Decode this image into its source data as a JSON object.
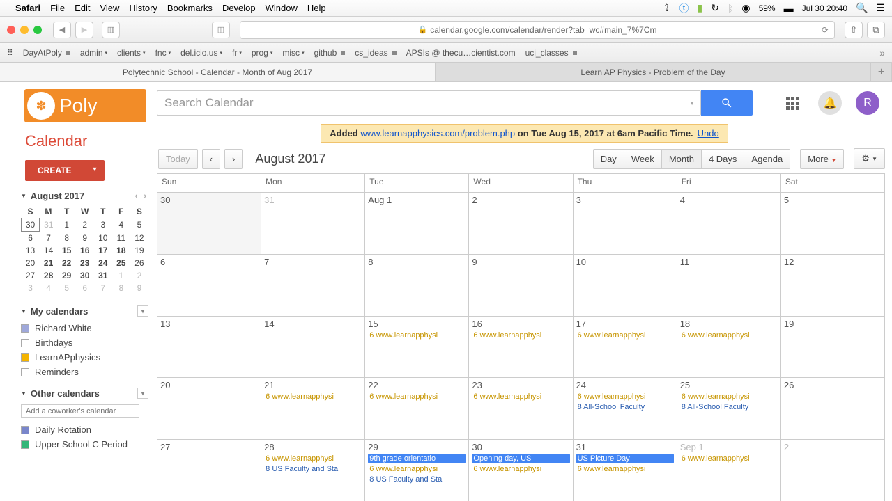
{
  "menubar": {
    "app": "Safari",
    "items": [
      "File",
      "Edit",
      "View",
      "History",
      "Bookmarks",
      "Develop",
      "Window",
      "Help"
    ],
    "battery": "59%",
    "datetime": "Jul 30  20:40"
  },
  "toolbar": {
    "url": "calendar.google.com/calendar/render?tab=wc#main_7%7Cm"
  },
  "favbar": [
    "DayAtPoly",
    "admin",
    "clients",
    "fnc",
    "del.icio.us",
    "fr",
    "prog",
    "misc",
    "github",
    "cs_ideas",
    "APSIs @ thecu…cientist.com",
    "uci_classes"
  ],
  "tabs": [
    "Polytechnic School - Calendar - Month of Aug 2017",
    "Learn AP Physics - Problem of the Day"
  ],
  "logo": "Poly",
  "search": {
    "placeholder": "Search Calendar"
  },
  "notif": {
    "prefix": "Added ",
    "link": "www.learnapphysics.com/problem.php",
    "suffix": " on Tue Aug 15, 2017 at 6am Pacific Time.",
    "undo": "Undo"
  },
  "calhdr": {
    "today": "Today",
    "month": "August 2017",
    "views": [
      "Day",
      "Week",
      "Month",
      "4 Days",
      "Agenda"
    ],
    "more": "More"
  },
  "sidebar": {
    "title": "Calendar",
    "create": "CREATE",
    "mini_month": "August 2017",
    "dow": [
      "S",
      "M",
      "T",
      "W",
      "T",
      "F",
      "S"
    ],
    "mini": [
      [
        {
          "n": "30",
          "t": "today"
        },
        {
          "n": "31",
          "t": "dim"
        },
        {
          "n": "1"
        },
        {
          "n": "2"
        },
        {
          "n": "3"
        },
        {
          "n": "4"
        },
        {
          "n": "5"
        }
      ],
      [
        {
          "n": "6"
        },
        {
          "n": "7"
        },
        {
          "n": "8"
        },
        {
          "n": "9"
        },
        {
          "n": "10"
        },
        {
          "n": "11"
        },
        {
          "n": "12"
        }
      ],
      [
        {
          "n": "13"
        },
        {
          "n": "14"
        },
        {
          "n": "15",
          "t": "bold"
        },
        {
          "n": "16",
          "t": "bold"
        },
        {
          "n": "17",
          "t": "bold"
        },
        {
          "n": "18",
          "t": "bold"
        },
        {
          "n": "19"
        }
      ],
      [
        {
          "n": "20"
        },
        {
          "n": "21",
          "t": "bold"
        },
        {
          "n": "22",
          "t": "bold"
        },
        {
          "n": "23",
          "t": "bold"
        },
        {
          "n": "24",
          "t": "bold"
        },
        {
          "n": "25",
          "t": "bold"
        },
        {
          "n": "26"
        }
      ],
      [
        {
          "n": "27"
        },
        {
          "n": "28",
          "t": "bold"
        },
        {
          "n": "29",
          "t": "bold"
        },
        {
          "n": "30",
          "t": "bold"
        },
        {
          "n": "31",
          "t": "bold"
        },
        {
          "n": "1",
          "t": "dim"
        },
        {
          "n": "2",
          "t": "dim"
        }
      ],
      [
        {
          "n": "3",
          "t": "dim"
        },
        {
          "n": "4",
          "t": "dim"
        },
        {
          "n": "5",
          "t": "dim"
        },
        {
          "n": "6",
          "t": "dim"
        },
        {
          "n": "7",
          "t": "dim"
        },
        {
          "n": "8",
          "t": "dim"
        },
        {
          "n": "9",
          "t": "dim"
        }
      ]
    ],
    "mycal_h": "My calendars",
    "mycal": [
      {
        "name": "Richard White",
        "c": "#9fa8da"
      },
      {
        "name": "Birthdays",
        "c": "#fff"
      },
      {
        "name": "LearnAPphysics",
        "c": "#f4b400"
      },
      {
        "name": "Reminders",
        "c": "#fff"
      }
    ],
    "othercal_h": "Other calendars",
    "addcow": "Add a coworker's calendar",
    "othercal": [
      {
        "name": "Daily Rotation",
        "c": "#7986cb"
      },
      {
        "name": "Upper School C Period",
        "c": "#33b679"
      }
    ]
  },
  "grid": {
    "dow": [
      "Sun",
      "Mon",
      "Tue",
      "Wed",
      "Thu",
      "Fri",
      "Sat"
    ],
    "weeks": [
      [
        {
          "n": "30",
          "dim": false,
          "past": true
        },
        {
          "n": "31",
          "dim": true
        },
        {
          "n": "Aug 1"
        },
        {
          "n": "2"
        },
        {
          "n": "3"
        },
        {
          "n": "4"
        },
        {
          "n": "5"
        }
      ],
      [
        {
          "n": "6"
        },
        {
          "n": "7"
        },
        {
          "n": "8"
        },
        {
          "n": "9"
        },
        {
          "n": "10"
        },
        {
          "n": "11"
        },
        {
          "n": "12"
        }
      ],
      [
        {
          "n": "13"
        },
        {
          "n": "14"
        },
        {
          "n": "15",
          "ev": [
            {
              "t": "6 www.learnapphysi",
              "c": "y"
            }
          ]
        },
        {
          "n": "16",
          "ev": [
            {
              "t": "6 www.learnapphysi",
              "c": "y"
            }
          ]
        },
        {
          "n": "17",
          "ev": [
            {
              "t": "6 www.learnapphysi",
              "c": "y"
            }
          ]
        },
        {
          "n": "18",
          "ev": [
            {
              "t": "6 www.learnapphysi",
              "c": "y"
            }
          ]
        },
        {
          "n": "19"
        }
      ],
      [
        {
          "n": "20"
        },
        {
          "n": "21",
          "ev": [
            {
              "t": "6 www.learnapphysi",
              "c": "y"
            }
          ]
        },
        {
          "n": "22",
          "ev": [
            {
              "t": "6 www.learnapphysi",
              "c": "y"
            }
          ]
        },
        {
          "n": "23",
          "ev": [
            {
              "t": "6 www.learnapphysi",
              "c": "y"
            }
          ]
        },
        {
          "n": "24",
          "ev": [
            {
              "t": "6 www.learnapphysi",
              "c": "y"
            },
            {
              "t": "8 All-School Faculty",
              "c": "b"
            }
          ]
        },
        {
          "n": "25",
          "ev": [
            {
              "t": "6 www.learnapphysi",
              "c": "y"
            },
            {
              "t": "8 All-School Faculty",
              "c": "b"
            }
          ]
        },
        {
          "n": "26"
        }
      ],
      [
        {
          "n": "27"
        },
        {
          "n": "28",
          "ev": [
            {
              "t": "6 www.learnapphysi",
              "c": "y"
            },
            {
              "t": "8 US Faculty and Sta",
              "c": "b"
            }
          ]
        },
        {
          "n": "29",
          "ev": [
            {
              "t": "9th grade orientatio",
              "c": "block"
            },
            {
              "t": "6 www.learnapphysi",
              "c": "y"
            },
            {
              "t": "8 US Faculty and Sta",
              "c": "b"
            }
          ]
        },
        {
          "n": "30",
          "ev": [
            {
              "t": "Opening day, US",
              "c": "block"
            },
            {
              "t": "6 www.learnapphysi",
              "c": "y"
            }
          ]
        },
        {
          "n": "31",
          "ev": [
            {
              "t": "US Picture Day",
              "c": "block"
            },
            {
              "t": "6 www.learnapphysi",
              "c": "y"
            }
          ]
        },
        {
          "n": "Sep 1",
          "dim": true,
          "ev": [
            {
              "t": "6 www.learnapphysi",
              "c": "y"
            }
          ]
        },
        {
          "n": "2",
          "dim": true
        }
      ]
    ]
  },
  "avatar": "R"
}
